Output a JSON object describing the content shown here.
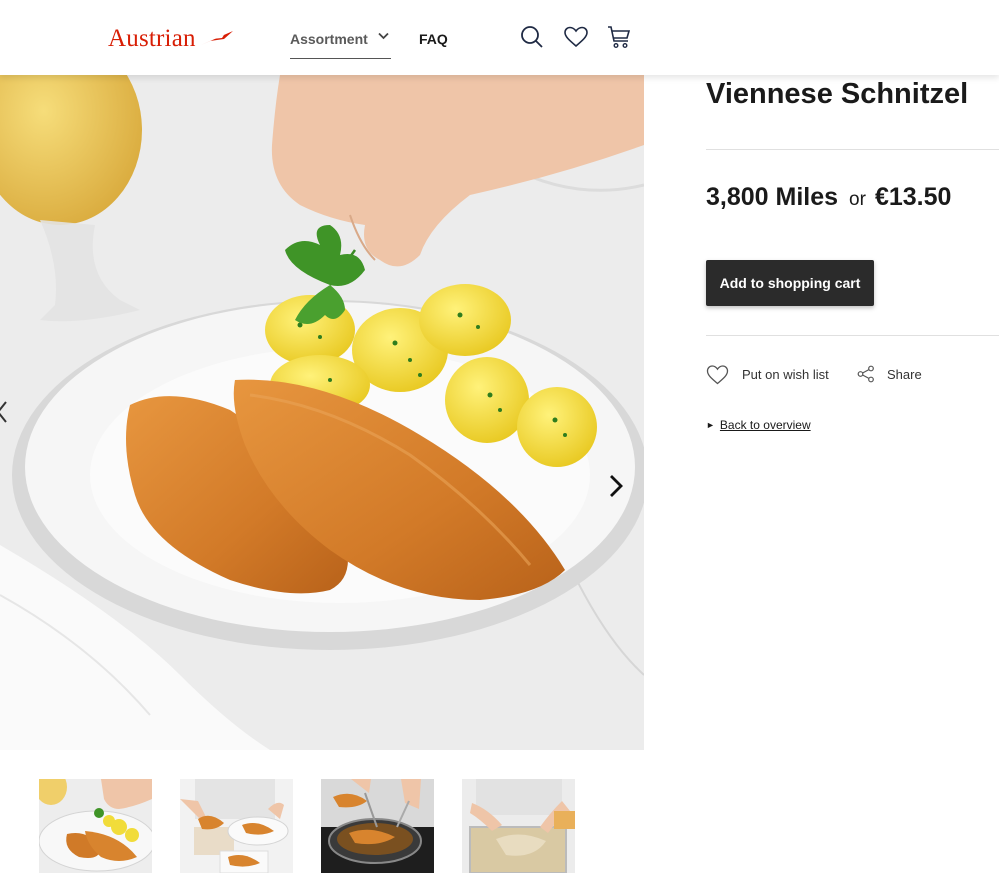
{
  "header": {
    "logo_text": "Austrian",
    "nav": {
      "assortment_label": "Assortment",
      "faq_label": "FAQ"
    },
    "icons": [
      "search-icon",
      "heart-icon",
      "cart-icon"
    ],
    "brand_color": "#d81e05"
  },
  "product": {
    "title": "Viennese Schnitzel",
    "price_miles": "3,800 Miles",
    "price_or": "or",
    "price_eur": "€13.50",
    "add_to_cart_label": "Add to shopping cart",
    "wishlist_label": "Put on wish list",
    "share_label": "Share",
    "back_arrow": "►",
    "back_label": "Back to overview"
  },
  "gallery": {
    "thumbnail_count": 4
  }
}
